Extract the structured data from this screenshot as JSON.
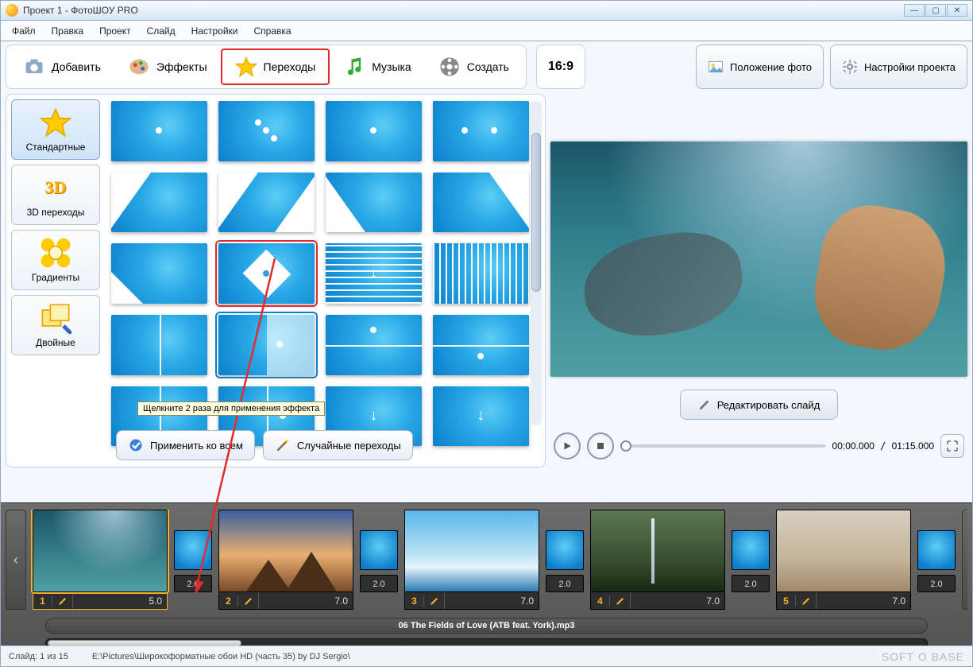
{
  "title": "Проект 1 - ФотоШОУ PRO",
  "menu": {
    "file": "Файл",
    "edit": "Правка",
    "project": "Проект",
    "slide": "Слайд",
    "settings": "Настройки",
    "help": "Справка"
  },
  "tabs": {
    "add": "Добавить",
    "effects": "Эффекты",
    "transitions": "Переходы",
    "music": "Музыка",
    "create": "Создать"
  },
  "aspect": "16:9",
  "rightTools": {
    "photoPos": "Положение фото",
    "projSettings": "Настройки проекта"
  },
  "categories": {
    "standard": "Стандартные",
    "three_d": "3D переходы",
    "gradients": "Градиенты",
    "double": "Двойные"
  },
  "tooltip": "Щелкните 2 раза для применения эффекта",
  "apply": {
    "all": "Применить ко всем",
    "random": "Случайные переходы"
  },
  "preview": {
    "editSlide": "Редактировать слайд",
    "timeCurrent": "00:00.000",
    "timeTotal": "01:15.000"
  },
  "timeline": {
    "slides": [
      {
        "num": "1",
        "dur": "5.0"
      },
      {
        "num": "2",
        "dur": "7.0"
      },
      {
        "num": "3",
        "dur": "7.0"
      },
      {
        "num": "4",
        "dur": "7.0"
      },
      {
        "num": "5",
        "dur": "7.0"
      }
    ],
    "transitions": [
      {
        "dur": "2.0"
      },
      {
        "dur": "2.0"
      },
      {
        "dur": "2.0"
      },
      {
        "dur": "2.0"
      },
      {
        "dur": "2.0"
      }
    ],
    "audio": "06 The Fields of Love (ATB feat. York).mp3"
  },
  "status": {
    "slide": "Слайд: 1 из 15",
    "path": "E:\\Pictures\\Широкоформатные обои HD (часть 35) by DJ Sergio\\",
    "brand": "SOFT O BASE"
  }
}
